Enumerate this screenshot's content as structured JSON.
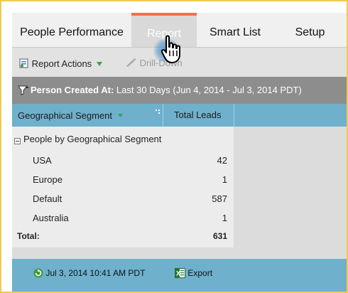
{
  "tabs": [
    {
      "label": "People Performance",
      "active": false
    },
    {
      "label": "Report",
      "active": true
    },
    {
      "label": "Smart List",
      "active": false
    },
    {
      "label": "Setup",
      "active": false
    }
  ],
  "toolbar": {
    "report_actions_label": "Report Actions",
    "drill_down_label": "Drill-Down"
  },
  "filter": {
    "field_label": "Person Created At:",
    "value": "Last 30 Days (Jun 4, 2014 - Jul 3, 2014 PDT)"
  },
  "table": {
    "columns": [
      "Geographical Segment",
      "Total Leads"
    ],
    "group_label": "People by Geographical Segment",
    "rows": [
      {
        "name": "USA",
        "value": "42"
      },
      {
        "name": "Europe",
        "value": "1"
      },
      {
        "name": "Default",
        "value": "587"
      },
      {
        "name": "Australia",
        "value": "1"
      }
    ],
    "total": {
      "label": "Total:",
      "value": "631"
    }
  },
  "footer": {
    "timestamp": "Jul 3, 2014 10:41 AM PDT",
    "export_label": "Export"
  },
  "colors": {
    "accent": "#e9744a",
    "header_blue": "#6fb0cc",
    "filter_gray": "#8d8d8d",
    "border_yellow": "#f2c94c"
  }
}
